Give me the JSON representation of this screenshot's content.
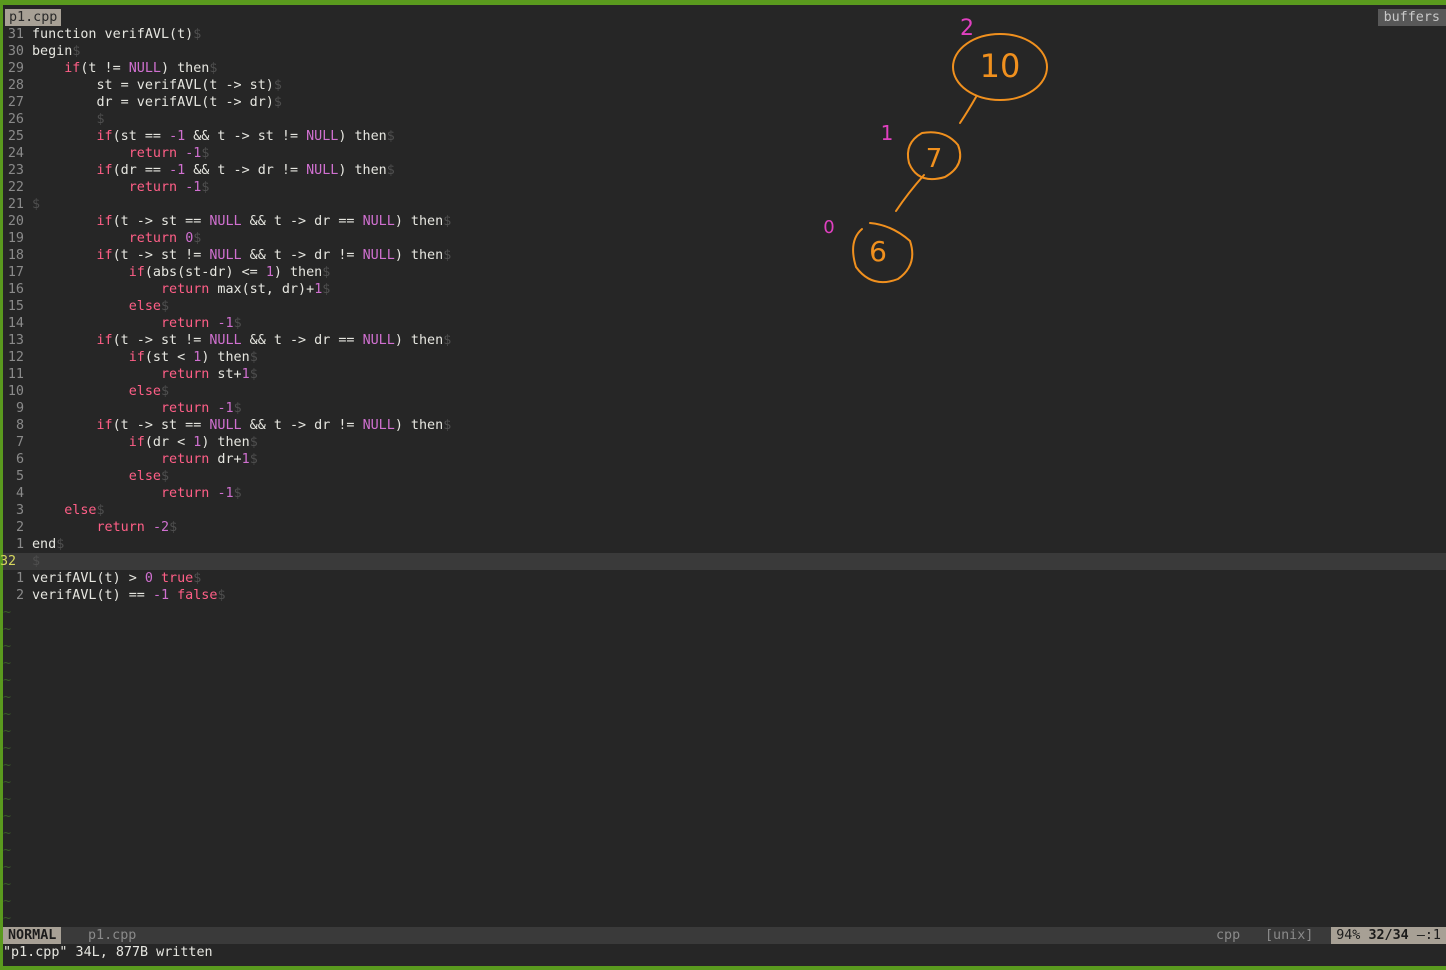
{
  "tab": {
    "file": "p1.cpp",
    "buffers": "buffers"
  },
  "status": {
    "mode": "NORMAL",
    "filename": "p1.cpp",
    "filetype": "cpp",
    "fileformat": "[unix]",
    "percent": "94%",
    "position": "32/34",
    "column": "—:1"
  },
  "cmdline": "\"p1.cpp\" 34L, 877B written",
  "lines": [
    {
      "n": "31",
      "t": "function verifAVL(t)"
    },
    {
      "n": "30",
      "t": "begin"
    },
    {
      "n": "29",
      "t": "    if(t != NULL) then"
    },
    {
      "n": "28",
      "t": "        st = verifAVL(t -> st)"
    },
    {
      "n": "27",
      "t": "        dr = verifAVL(t -> dr)"
    },
    {
      "n": "26",
      "t": "        "
    },
    {
      "n": "25",
      "t": "        if(st == -1 && t -> st != NULL) then"
    },
    {
      "n": "24",
      "t": "            return -1"
    },
    {
      "n": "23",
      "t": "        if(dr == -1 && t -> dr != NULL) then"
    },
    {
      "n": "22",
      "t": "            return -1"
    },
    {
      "n": "21",
      "t": ""
    },
    {
      "n": "20",
      "t": "        if(t -> st == NULL && t -> dr == NULL) then"
    },
    {
      "n": "19",
      "t": "            return 0"
    },
    {
      "n": "18",
      "t": "        if(t -> st != NULL && t -> dr != NULL) then"
    },
    {
      "n": "17",
      "t": "            if(abs(st-dr) <= 1) then"
    },
    {
      "n": "16",
      "t": "                return max(st, dr)+1"
    },
    {
      "n": "15",
      "t": "            else"
    },
    {
      "n": "14",
      "t": "                return -1"
    },
    {
      "n": "13",
      "t": "        if(t -> st != NULL && t -> dr == NULL) then"
    },
    {
      "n": "12",
      "t": "            if(st < 1) then"
    },
    {
      "n": "11",
      "t": "                return st+1"
    },
    {
      "n": "10",
      "t": "            else"
    },
    {
      "n": "9",
      "t": "                return -1"
    },
    {
      "n": "8",
      "t": "        if(t -> st == NULL && t -> dr != NULL) then"
    },
    {
      "n": "7",
      "t": "            if(dr < 1) then"
    },
    {
      "n": "6",
      "t": "                return dr+1"
    },
    {
      "n": "5",
      "t": "            else"
    },
    {
      "n": "4",
      "t": "                return -1"
    },
    {
      "n": "3",
      "t": "    else"
    },
    {
      "n": "2",
      "t": "        return -2"
    },
    {
      "n": "1",
      "t": "end"
    },
    {
      "n": "32",
      "t": "",
      "cursor": true
    },
    {
      "n": "1",
      "t": "verifAVL(t) > 0 true"
    },
    {
      "n": "2",
      "t": "verifAVL(t) == -1 false"
    }
  ],
  "eol_marker": "$",
  "tilde": "~",
  "drawing": {
    "nodes": [
      "10",
      "7",
      "6"
    ],
    "heights": [
      "2",
      "1",
      "0"
    ],
    "stroke_color": "#f0901e",
    "height_color": "#e040c0"
  }
}
